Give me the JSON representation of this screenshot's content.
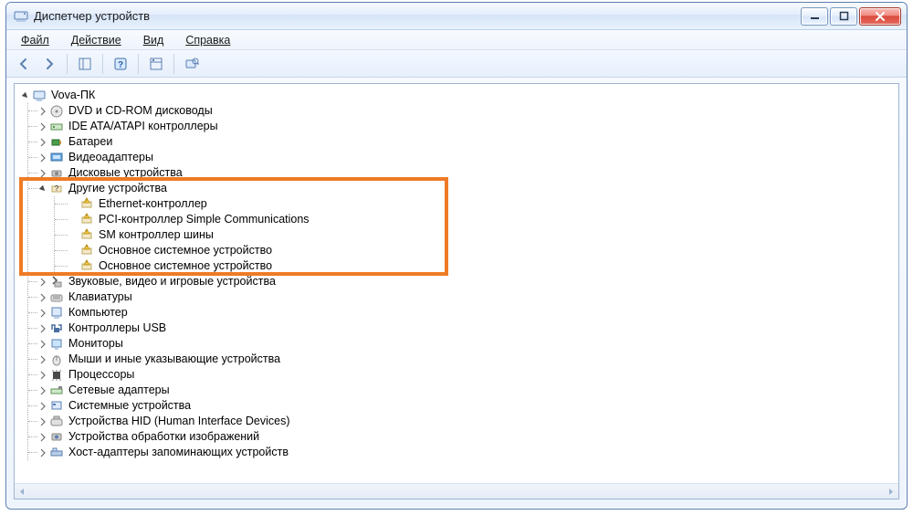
{
  "window": {
    "title": "Диспетчер устройств"
  },
  "menu": {
    "file": "Файл",
    "action": "Действие",
    "view": "Вид",
    "help": "Справка"
  },
  "tree": {
    "root": "Vova-ПК",
    "categories": [
      {
        "label": "DVD и CD-ROM дисководы"
      },
      {
        "label": "IDE ATA/ATAPI контроллеры"
      },
      {
        "label": "Батареи"
      },
      {
        "label": "Видеоадаптеры"
      },
      {
        "label": "Дисковые устройства"
      },
      {
        "label": "Другие устройства",
        "expanded": true,
        "warn": true,
        "items": [
          "Ethernet-контроллер",
          "PCI-контроллер Simple Communications",
          "SM контроллер шины",
          "Основное системное устройство",
          "Основное системное устройство"
        ]
      },
      {
        "label": "Звуковые, видео и игровые устройства"
      },
      {
        "label": "Клавиатуры"
      },
      {
        "label": "Компьютер"
      },
      {
        "label": "Контроллеры USB"
      },
      {
        "label": "Мониторы"
      },
      {
        "label": "Мыши и иные указывающие устройства"
      },
      {
        "label": "Процессоры"
      },
      {
        "label": "Сетевые адаптеры"
      },
      {
        "label": "Системные устройства"
      },
      {
        "label": "Устройства HID (Human Interface Devices)"
      },
      {
        "label": "Устройства обработки изображений"
      },
      {
        "label": "Хост-адаптеры запоминающих устройств"
      }
    ]
  }
}
